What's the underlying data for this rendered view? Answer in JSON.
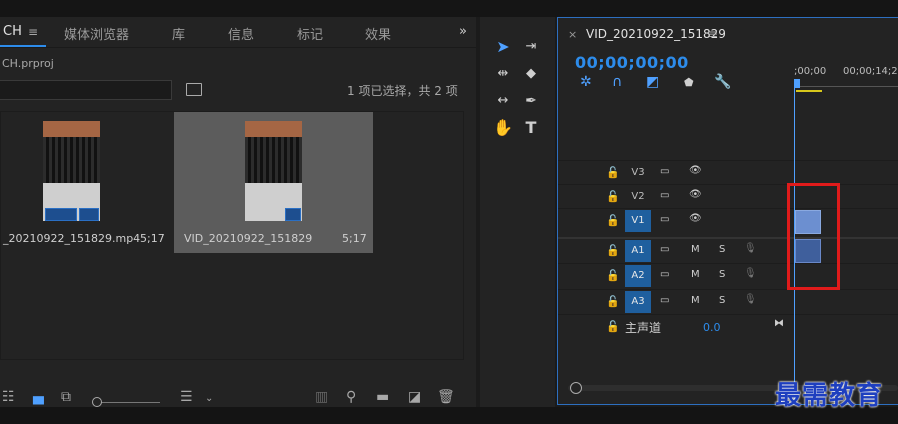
{
  "project_panel": {
    "tabs": [
      {
        "label": "CH",
        "active": true
      },
      {
        "label": "媒体浏览器"
      },
      {
        "label": "库"
      },
      {
        "label": "信息"
      },
      {
        "label": "标记"
      },
      {
        "label": "效果"
      }
    ],
    "menu_glyph": "≡",
    "overflow_glyph": "»",
    "project_file": "CH.prproj",
    "selection_info": "1 项已选择，共 2 项",
    "clips": [
      {
        "name": "_20210922_151829.mp4",
        "duration": "5;17",
        "selected": false
      },
      {
        "name": "VID_20210922_151829",
        "duration": "5;17",
        "selected": true
      }
    ]
  },
  "timeline": {
    "close_glyph": "×",
    "title": "VID_20210922_151829",
    "menu_glyph": "≡",
    "timecode": "00;00;00;00",
    "ruler": [
      ";00;00",
      "00;00;14;29"
    ],
    "video_tracks": [
      "V3",
      "V2",
      "V1"
    ],
    "audio_tracks": [
      "A1",
      "A2",
      "A3"
    ],
    "active_tracks": [
      "V1",
      "A1",
      "A2",
      "A3"
    ],
    "mute_label": "M",
    "solo_label": "S",
    "master_label": "主声道",
    "master_value": "0.0"
  },
  "watermark": "最需教育",
  "colors": {
    "accent": "#2d8ceb",
    "highlight": "#e01b1b",
    "track_on": "#1f5f9e"
  }
}
